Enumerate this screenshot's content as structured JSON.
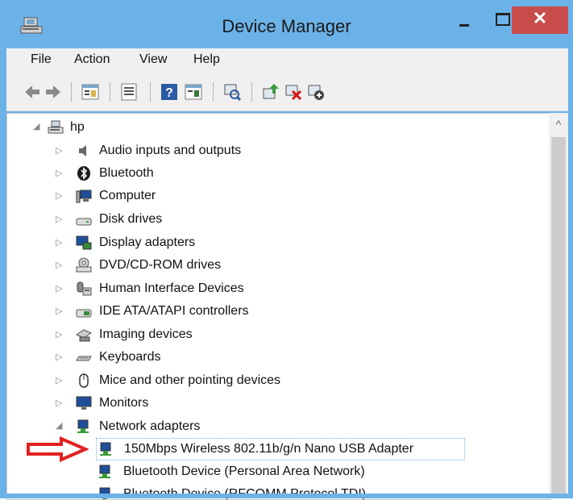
{
  "window": {
    "title": "Device Manager",
    "close_glyph": "✕"
  },
  "menu": {
    "file": "File",
    "action": "Action",
    "view": "View",
    "help": "Help"
  },
  "toolbar": {
    "icons": [
      "back-icon",
      "forward-icon",
      "properties-view-icon",
      "list-icon",
      "help-icon",
      "console-tree-icon",
      "scan-icon",
      "update-driver-icon",
      "disable-icon",
      "uninstall-icon"
    ]
  },
  "tree": {
    "root": "hp",
    "categories": [
      "Audio inputs and outputs",
      "Bluetooth",
      "Computer",
      "Disk drives",
      "Display adapters",
      "DVD/CD-ROM drives",
      "Human Interface Devices",
      "IDE ATA/ATAPI controllers",
      "Imaging devices",
      "Keyboards",
      "Mice and other pointing devices",
      "Monitors",
      "Network adapters"
    ],
    "network_devices": [
      "150Mbps Wireless 802.11b/g/n Nano USB Adapter",
      "Bluetooth Device (Personal Area Network)",
      "Bluetooth Device (RFCOMM Protocol TDI)"
    ]
  },
  "colors": {
    "titlebar": "#6bb2e8",
    "close_button": "#c94c4c",
    "arrow": "#e22121",
    "selection_border": "#7fb0e0"
  }
}
